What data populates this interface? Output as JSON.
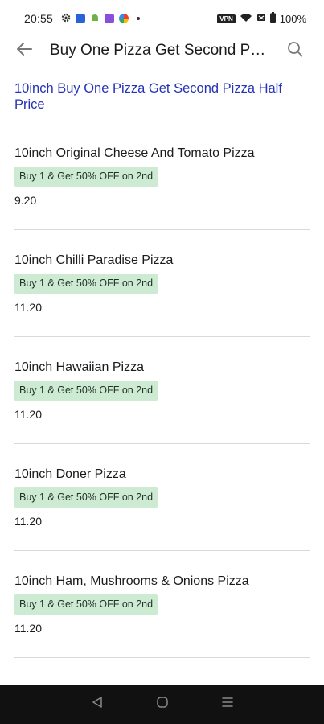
{
  "status_bar": {
    "time": "20:55",
    "battery": "100%",
    "vpn": "VPN",
    "icons": [
      "settings-gear-icon",
      "messages-icon",
      "android-icon",
      "app-icon",
      "browser-icon",
      "dot-icon",
      "wifi-icon",
      "no-sim-icon",
      "battery-icon"
    ]
  },
  "app_bar": {
    "title": "Buy One Pizza Get Second Pizza Half Price",
    "back_icon": "arrow-left-icon",
    "search_icon": "search-icon"
  },
  "category": {
    "title": "10inch Buy One Pizza Get Second Pizza Half Price",
    "color": "#2433b8"
  },
  "items": [
    {
      "name": "10inch Original Cheese And Tomato Pizza",
      "offer": "Buy 1 & Get 50% OFF on 2nd",
      "price": "9.20"
    },
    {
      "name": "10inch Chilli Paradise Pizza",
      "offer": "Buy 1 & Get 50% OFF on 2nd",
      "price": "11.20"
    },
    {
      "name": "10inch Hawaiian Pizza",
      "offer": "Buy 1 & Get 50% OFF on 2nd",
      "price": "11.20"
    },
    {
      "name": "10inch Doner Pizza",
      "offer": "Buy 1 & Get 50% OFF on 2nd",
      "price": "11.20"
    },
    {
      "name": "10inch Ham, Mushrooms & Onions Pizza",
      "offer": "Buy 1 & Get 50% OFF on 2nd",
      "price": "11.20"
    }
  ],
  "colors": {
    "offer_badge_bg": "#cdebd2",
    "nav_bar_bg": "#111111"
  },
  "nav_bar": {
    "icons": [
      "back-triangle-icon",
      "home-circle-icon",
      "recents-menu-icon"
    ]
  }
}
